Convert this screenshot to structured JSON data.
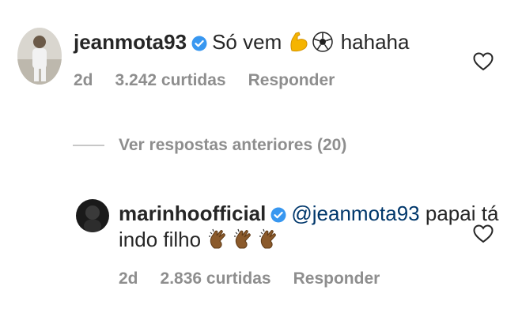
{
  "comments": [
    {
      "username": "jeanmota93",
      "verified": true,
      "text": "Só vem",
      "emojis": [
        "flexed-biceps",
        "soccer-ball"
      ],
      "text_after": "hahaha",
      "time": "2d",
      "likes": "3.242 curtidas",
      "reply_label": "Responder"
    },
    {
      "username": "marinhoofficial",
      "verified": true,
      "mention": "@jeanmota93",
      "text": "papai tá",
      "text_line2": "indo filho",
      "emojis": [
        "clapping-hands",
        "clapping-hands",
        "clapping-hands"
      ],
      "time": "2d",
      "likes": "2.836 curtidas",
      "reply_label": "Responder"
    }
  ],
  "view_replies": "Ver respostas anteriores (20)",
  "colors": {
    "verified": "#3897f0",
    "mention": "#00376b",
    "muted": "#8e8e8e"
  }
}
